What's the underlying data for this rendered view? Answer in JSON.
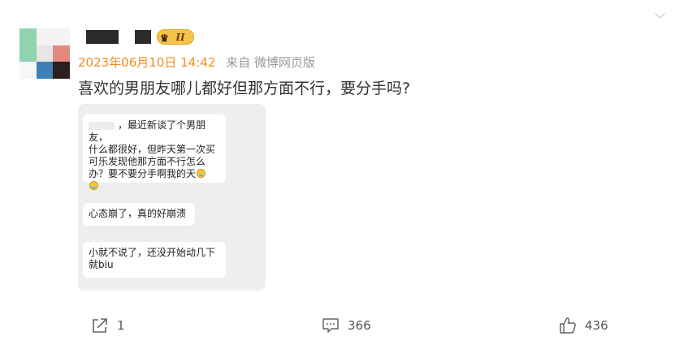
{
  "post": {
    "timestamp": "2023年06月10日 14:42",
    "source": "来自 微博网页版",
    "text": "喜欢的男朋友哪儿都好但那方面不行，要分手吗?",
    "badge_label": "II"
  },
  "chat_image": {
    "messages": [
      {
        "text_lines": [
          "，最近新谈了个男朋友，",
          "什么都很好，但昨天第一次买",
          "可乐发现他那方面不行怎么",
          "办？要不要分手啊我的天"
        ]
      },
      {
        "text_lines": [
          "心态崩了，真的好崩溃"
        ]
      },
      {
        "text_lines": [
          "小就不说了，还没开始动几下",
          "就biu"
        ]
      }
    ]
  },
  "actions": {
    "share_count": "1",
    "comment_count": "366",
    "like_count": "436"
  },
  "icons": {
    "share": "share-icon",
    "comment": "comment-icon",
    "like": "like-icon",
    "more": "chevron-down-icon"
  },
  "colors": {
    "timestamp": "#f68b1f",
    "badge": "#f6c443",
    "card_bg": "#eeeeee"
  }
}
